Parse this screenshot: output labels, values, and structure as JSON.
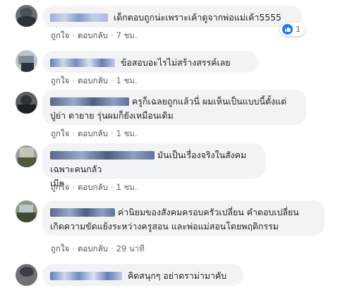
{
  "actions": {
    "like": "ถูกใจ",
    "reply": "ตอบกลับ",
    "separator": "·"
  },
  "comments": [
    {
      "author": "Kafeek Td",
      "text": "เด็กตอบถูกน่ะเพราะเค้าดูจากพ่อแม่เค้า5555",
      "time": "7 ชม.",
      "reaction_count": "1",
      "reaction_icon": "like-icon"
    },
    {
      "author": "",
      "text": "ข้อสอบอะไรไม่สร้างสรรค์เลย",
      "time": "1 ชม."
    },
    {
      "author": "",
      "text_line1": "ครูก็เฉลยถูกแล้วนี่ ผมเห็นเป็นแบบนี้ตั้งแต่",
      "text_line2": "ปู่ย่า ตายาย รุ่นผมก็ยังเหมือนเดิม",
      "time": "1 ชม."
    },
    {
      "author": "",
      "text_line1": "มันเป็นเรื่องจริงในสังคม เฉพาะคนกลัว",
      "text_line2": "เมีย",
      "time": "1 ชม."
    },
    {
      "author": "",
      "text_line1": "ค่านิยมของสังคมครอบครัวเปลี่ยน คำตอบเปลี่ยน",
      "text_line2": "เกิดความขัดแย้งระหว่างครูสอน และพ่อแม่สอนโดยพฤติกรรม",
      "time": "29 นาที"
    },
    {
      "author": "",
      "text": "คิดสนุกๆ อย่าดราม่ามาคับ"
    }
  ],
  "colors": {
    "bubble": "#f2f3f5",
    "link": "#4b4f56",
    "like_blue": "#1877f2"
  }
}
